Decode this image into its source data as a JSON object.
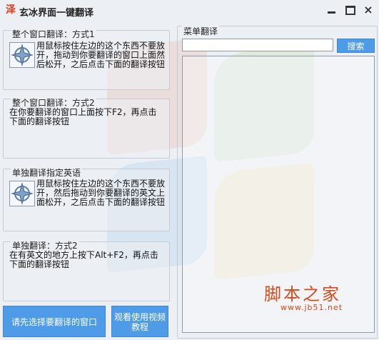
{
  "window": {
    "title": "玄冰界面一键翻译",
    "app_icon": "泽"
  },
  "groups": [
    {
      "title": "整个窗口翻译：方式1",
      "text": "用鼠标按住左边的这个东西不要放开，拖动到你要翻译的窗口上面然后松开，之后点击下面的翻译按钮",
      "icon": "drag-target-icon"
    },
    {
      "title": "整个窗口翻译：方式2",
      "text": "在你要翻译的窗口上面按下F2，再点击下面的翻译按钮"
    },
    {
      "title": "单独翻译指定英语",
      "text": "用鼠标按住左边的这个东西不要放开，然后拖动到你要翻译的英文上面松开，之后点击下面的翻译按钮",
      "icon": "drag-target-icon"
    },
    {
      "title": "单独翻译：方式2",
      "text": "在有英文的地方上按下Alt+F2，再点击下面的翻译按钮"
    }
  ],
  "menu_translate": {
    "title": "菜单翻译",
    "search_value": "",
    "search_button": "搜索"
  },
  "buttons": {
    "select_window": "请先选择要翻译的窗口",
    "tutorial": "观看使用视频教程"
  },
  "watermark": {
    "text": "脚本之家",
    "url": "www.jb51.net"
  }
}
